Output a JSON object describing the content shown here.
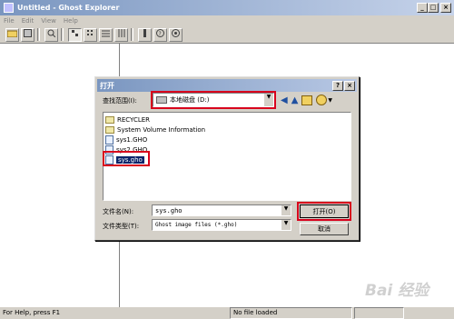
{
  "window": {
    "title": "Untitled - Ghost Explorer",
    "minimize": "_",
    "maximize": "□",
    "close": "×"
  },
  "menu": [
    "File",
    "Edit",
    "View",
    "Help"
  ],
  "toolbar": {
    "buttons": [
      "open-folder",
      "save",
      "find",
      "large-icons",
      "small-icons",
      "list",
      "details",
      "properties",
      "help",
      "about"
    ]
  },
  "status": {
    "help_text": "For Help, press F1",
    "file_state": "No file loaded"
  },
  "dialog": {
    "title": "打开",
    "help": "?",
    "close": "×",
    "look_in_label": "查找范围(I):",
    "look_in_value": "本地磁盘 (D:)",
    "files": [
      {
        "name": "RECYCLER",
        "type": "folder"
      },
      {
        "name": "System Volume Information",
        "type": "folder"
      },
      {
        "name": "sys1.GHO",
        "type": "gho"
      },
      {
        "name": "sys2.GHO",
        "type": "gho"
      },
      {
        "name": "sys.gho",
        "type": "gho",
        "selected": true
      }
    ],
    "filename_label": "文件名(N):",
    "filename_value": "sys.gho",
    "filetype_label": "文件类型(T):",
    "filetype_value": "Ghost image files (*.gho)",
    "open_button": "打开(O)",
    "cancel_button": "取消"
  },
  "watermark": "Bai 经验",
  "colors": {
    "highlight_border": "#d8001c",
    "selection": "#0a246a"
  }
}
